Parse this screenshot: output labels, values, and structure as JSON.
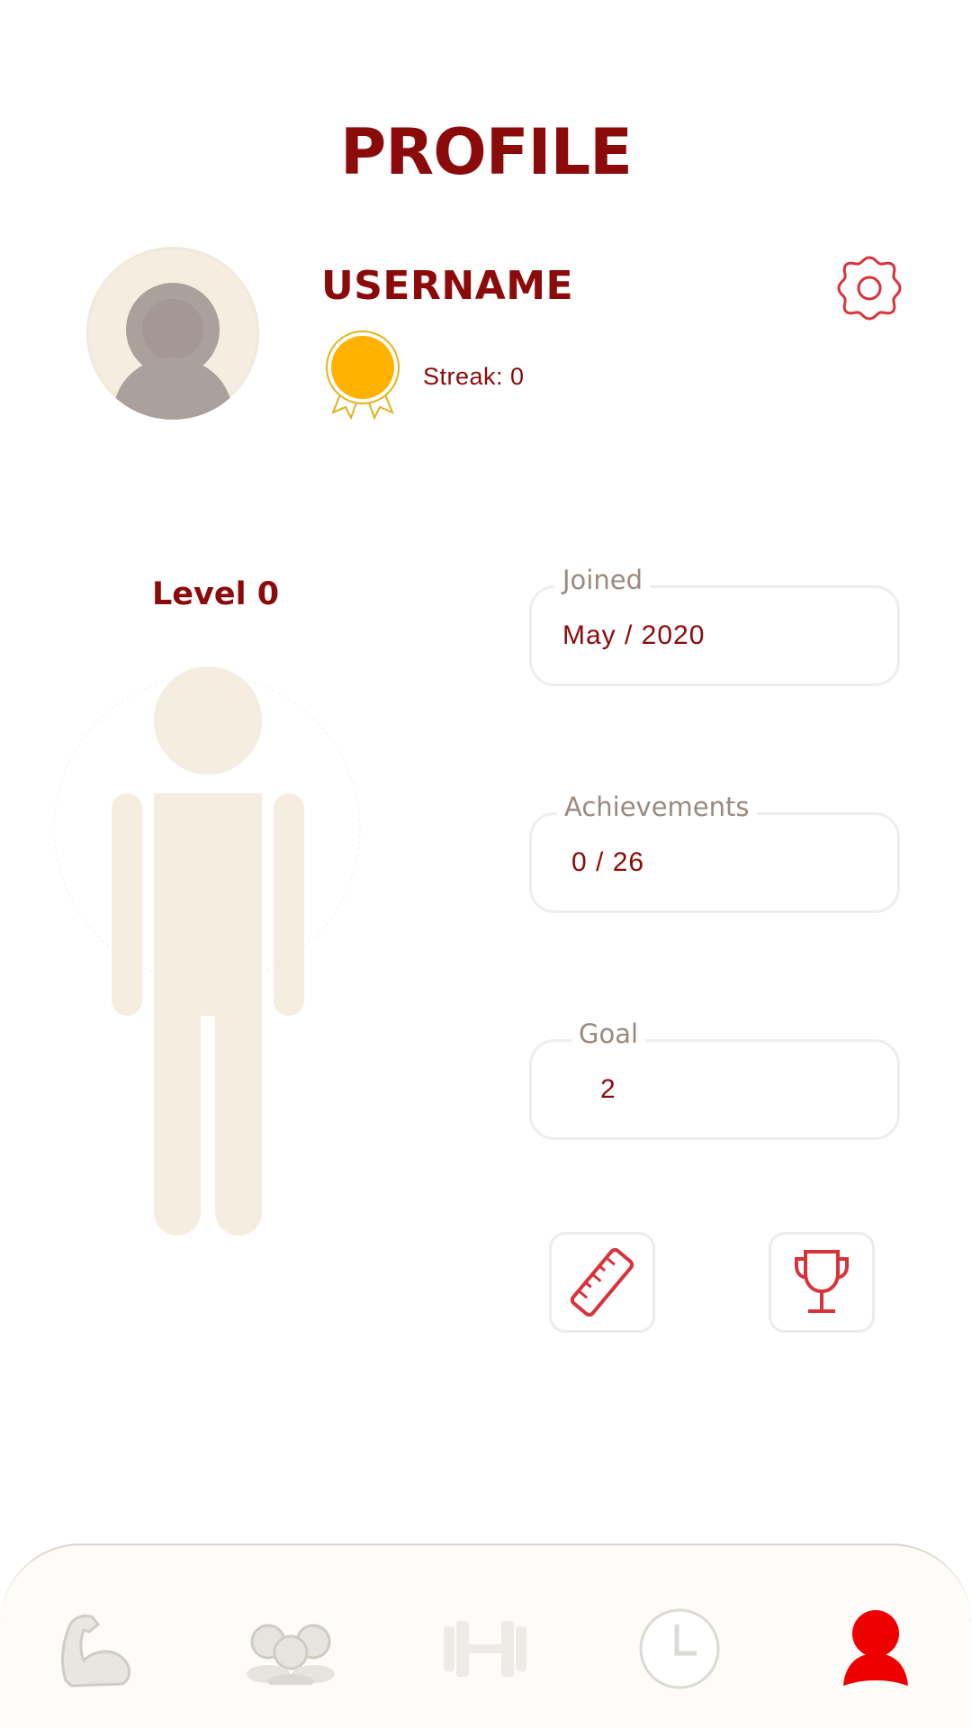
{
  "header": {
    "title": "PROFILE"
  },
  "profile": {
    "username": "USERNAME",
    "streak_text": "Streak: 0",
    "level_text": "Level 0"
  },
  "fields": {
    "joined": {
      "label": "Joined",
      "value": "May / 2020"
    },
    "achievements": {
      "label": "Achievements",
      "value": "0 / 26"
    },
    "goal": {
      "label": "Goal",
      "value": "2"
    }
  },
  "icons": {
    "settings": "gear-icon",
    "medal": "medal-icon",
    "measure": "ruler-icon",
    "trophy": "trophy-icon",
    "nav": [
      "muscle-arm-icon",
      "group-icon",
      "dumbbell-icon",
      "clock-icon",
      "profile-icon"
    ]
  },
  "colors": {
    "brand": "#8b0a0a",
    "accent_red": "#d8333a",
    "medal": "#ffb200",
    "nav_active": "#ee0000",
    "figure": "#f4ede0"
  }
}
